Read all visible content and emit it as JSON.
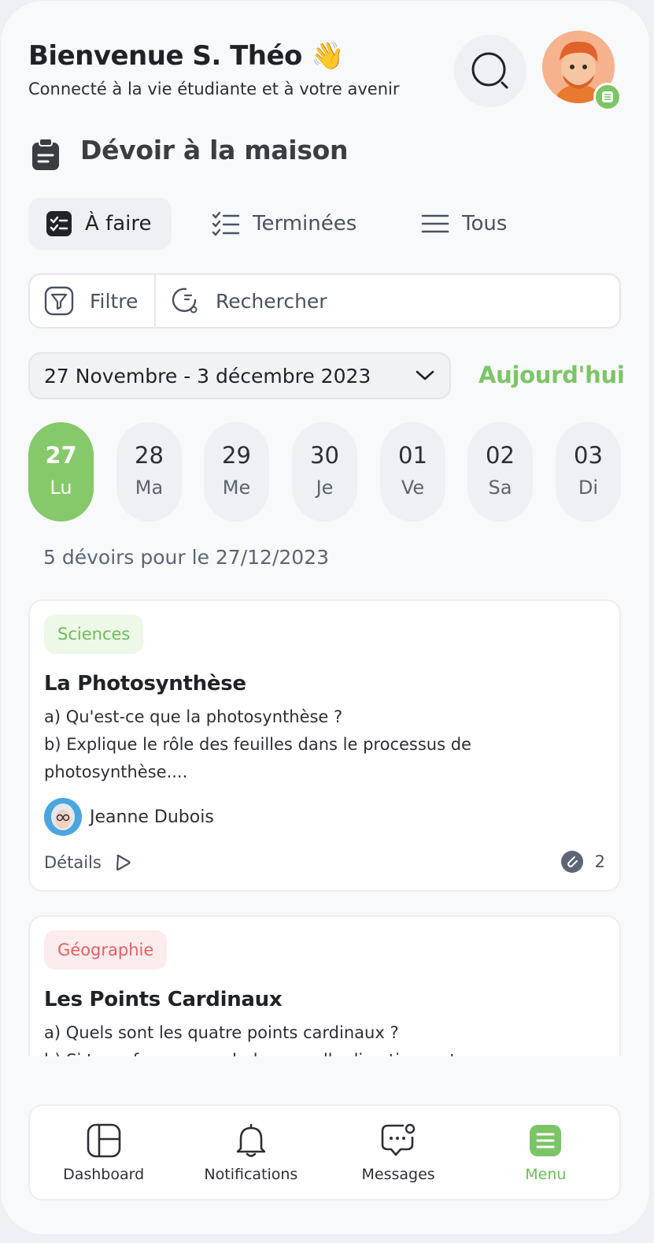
{
  "header": {
    "title": "Bienvenue S. Théo 👋",
    "subtitle": "Connecté à la vie étudiante et à votre avenir"
  },
  "section": {
    "title": "Dévoir à la maison"
  },
  "tabs": [
    {
      "label": "À faire",
      "active": true
    },
    {
      "label": "Terminées",
      "active": false
    },
    {
      "label": "Tous",
      "active": false
    }
  ],
  "toolbar": {
    "filter_label": "Filtre",
    "search_label": "Rechercher"
  },
  "date_range": {
    "label": "27 Novembre - 3 décembre 2023",
    "today_label": "Aujourd'hui"
  },
  "days": [
    {
      "num": "27",
      "label": "Lu",
      "active": true
    },
    {
      "num": "28",
      "label": "Ma",
      "active": false
    },
    {
      "num": "29",
      "label": "Me",
      "active": false
    },
    {
      "num": "30",
      "label": "Je",
      "active": false
    },
    {
      "num": "01",
      "label": "Ve",
      "active": false
    },
    {
      "num": "02",
      "label": "Sa",
      "active": false
    },
    {
      "num": "03",
      "label": "Di",
      "active": false
    }
  ],
  "count_label": "5 dévoirs pour le 27/12/2023",
  "cards": [
    {
      "subject": "Sciences",
      "title": "La Photosynthèse",
      "line1": "a) Qu'est-ce que la photosynthèse ?",
      "line2": "b) Explique le rôle des feuilles dans le processus de photosynthèse....",
      "teacher": "Jeanne Dubois",
      "details_label": "Détails",
      "attachments": "2"
    },
    {
      "subject": "Géographie",
      "title": "Les Points Cardinaux",
      "line1": "a) Quels sont les quatre points cardinaux ?",
      "line2": "b) Si tu es face au nord, dans quelle direction se trouve..."
    }
  ],
  "nav": [
    {
      "label": "Dashboard",
      "icon": "dashboard-icon"
    },
    {
      "label": "Notifications",
      "icon": "bell-icon"
    },
    {
      "label": "Messages",
      "icon": "message-icon"
    },
    {
      "label": "Menu",
      "icon": "menu-icon",
      "active": true
    }
  ],
  "colors": {
    "accent": "#7cc566",
    "science": "#6cbf55",
    "geography": "#e26060"
  }
}
